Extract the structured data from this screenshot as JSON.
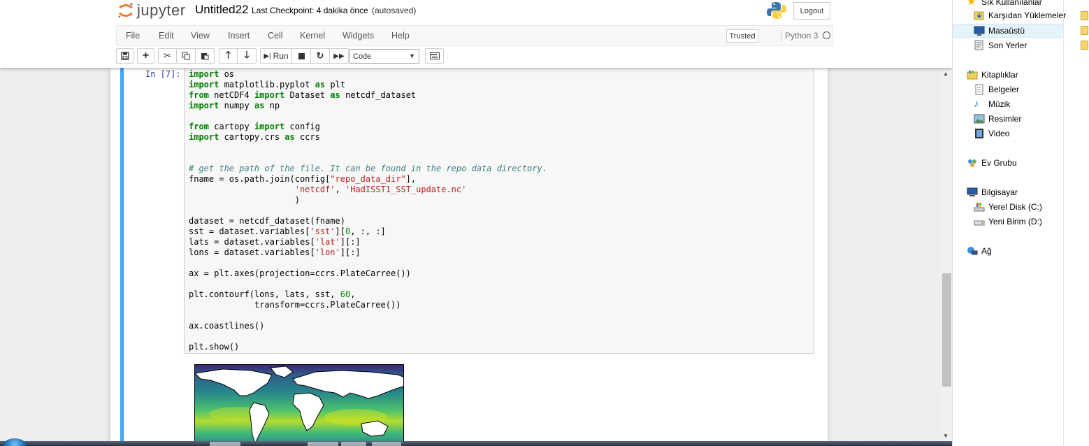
{
  "app": {
    "logo_text": "jupyter",
    "notebook_title": "Untitled22",
    "checkpoint": "Last Checkpoint: 4 dakika önce",
    "autosaved": "(autosaved)",
    "logout_label": "Logout"
  },
  "menu": {
    "items": [
      "File",
      "Edit",
      "View",
      "Insert",
      "Cell",
      "Kernel",
      "Widgets",
      "Help"
    ],
    "trusted": "Trusted",
    "kernel": "Python 3"
  },
  "toolbar": {
    "run_label": "Run",
    "cell_type": "Code"
  },
  "cell": {
    "prompt": "In [7]:",
    "lines": [
      "import os",
      "import matplotlib.pyplot as plt",
      "from netCDF4 import Dataset as netcdf_dataset",
      "import numpy as np",
      "",
      "from cartopy import config",
      "import cartopy.crs as ccrs",
      "",
      "",
      "# get the path of the file. It can be found in the repo data directory.",
      "fname = os.path.join(config[\"repo_data_dir\"],",
      "                     'netcdf', 'HadISST1_SST_update.nc'",
      "                     )",
      "",
      "dataset = netcdf_dataset(fname)",
      "sst = dataset.variables['sst'][0, :, :]",
      "lats = dataset.variables['lat'][:]",
      "lons = dataset.variables['lon'][:]",
      "",
      "ax = plt.axes(projection=ccrs.PlateCarree())",
      "",
      "plt.contourf(lons, lats, sst, 60,",
      "             transform=ccrs.PlateCarree())",
      "",
      "ax.coastlines()",
      "",
      "plt.show()"
    ]
  },
  "explorer": {
    "favorites": "Sık Kullanılanlar",
    "downloads": "Karşıdan Yüklemeler",
    "desktop": "Masaüstü",
    "recent": "Son Yerler",
    "libraries": "Kitaplıklar",
    "documents": "Belgeler",
    "music": "Müzik",
    "pictures": "Resimler",
    "video": "Video",
    "homegroup": "Ev Grubu",
    "computer": "Bilgisayar",
    "disk_c": "Yerel Disk (C:)",
    "disk_d": "Yeni Birim (D:)",
    "network": "Ağ"
  },
  "colors": {
    "accent": "#42a5f5",
    "keyword": "#008000",
    "string": "#ba2121",
    "comment": "#408080"
  }
}
